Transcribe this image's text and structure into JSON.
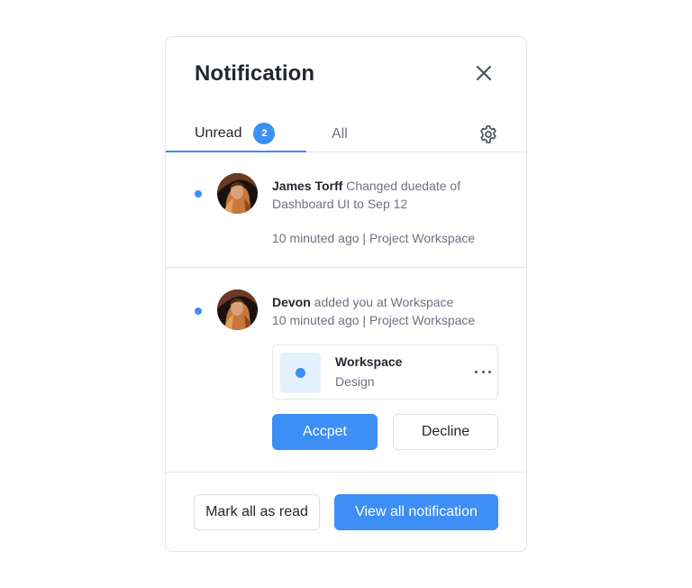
{
  "header": {
    "title": "Notification"
  },
  "tabs": {
    "unread_label": "Unread",
    "unread_count": "2",
    "all_label": "All"
  },
  "notifications": [
    {
      "user": "James Torff",
      "action": " Changed duedate of Dashboard UI to Sep 12",
      "time": "10 minuted ago",
      "separator": "|",
      "workspace": "Project Workspace",
      "unread": true
    },
    {
      "user": "Devon",
      "action": " added you at Workspace",
      "time": "10 minuted ago",
      "separator": "|",
      "workspace": "Project Workspace",
      "unread": true,
      "card": {
        "title": "Workspace",
        "subtitle": "Design"
      },
      "accept_label": "Accpet",
      "decline_label": "Decline"
    }
  ],
  "footer": {
    "mark_read_label": "Mark all as read",
    "view_all_label": "View all notification"
  },
  "icons": {
    "close": "close-icon",
    "settings": "gear-icon",
    "more": "more-horizontal-icon",
    "unread_dot": "unread-dot"
  },
  "colors": {
    "accent": "#3d8ef5",
    "text_primary": "#23272e",
    "text_secondary": "#6b7280",
    "border": "#e3e5e8",
    "thumb_bg": "#e3f0fd"
  }
}
